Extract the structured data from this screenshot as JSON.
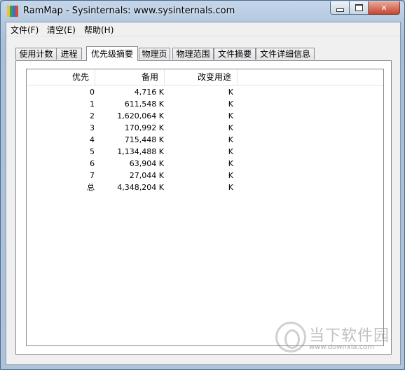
{
  "window": {
    "title": "RamMap - Sysinternals: www.sysinternals.com"
  },
  "menu": [
    {
      "label": "文件(F)"
    },
    {
      "label": "清空(E)"
    },
    {
      "label": "帮助(H)"
    }
  ],
  "tabs": [
    {
      "label": "使用计数"
    },
    {
      "label": "进程"
    },
    {
      "label": "优先级摘要",
      "active": true
    },
    {
      "label": "物理页"
    },
    {
      "label": "物理范围"
    },
    {
      "label": "文件摘要"
    },
    {
      "label": "文件详细信息"
    }
  ],
  "table": {
    "columns": [
      "优先",
      "备用",
      "改变用途"
    ],
    "rows": [
      [
        "0",
        "4,716 K",
        "K"
      ],
      [
        "1",
        "611,548 K",
        "K"
      ],
      [
        "2",
        "1,620,064 K",
        "K"
      ],
      [
        "3",
        "170,992 K",
        "K"
      ],
      [
        "4",
        "715,448 K",
        "K"
      ],
      [
        "5",
        "1,134,488 K",
        "K"
      ],
      [
        "6",
        "63,904 K",
        "K"
      ],
      [
        "7",
        "27,044 K",
        "K"
      ],
      [
        "总",
        "4,348,204 K",
        "K"
      ]
    ]
  },
  "watermark": {
    "brand": "当下软件园",
    "url": "www.downxia.com"
  },
  "colors": {
    "titlebar": "#b9cde3",
    "close_button": "#c8462f"
  }
}
